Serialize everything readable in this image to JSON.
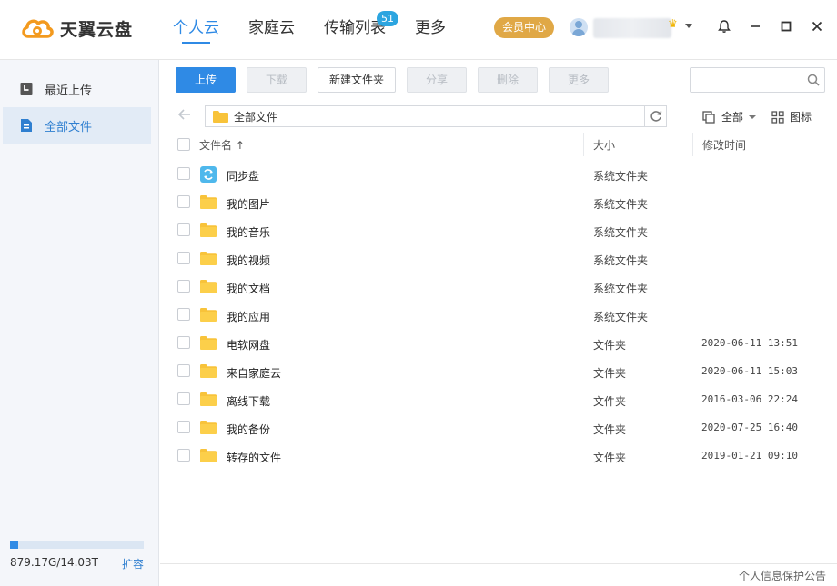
{
  "app": {
    "logo_text": "天翼云盘"
  },
  "nav": {
    "items": [
      {
        "label": "个人云"
      },
      {
        "label": "家庭云"
      },
      {
        "label": "传输列表",
        "badge": "51"
      },
      {
        "label": "更多"
      }
    ]
  },
  "header": {
    "vip_label": "会员中心"
  },
  "sidebar": {
    "items": [
      {
        "label": "最近上传"
      },
      {
        "label": "全部文件"
      }
    ],
    "storage_text": "879.17G/14.03T",
    "storage_used_fraction": 0.061,
    "expand_label": "扩容"
  },
  "toolbar": {
    "upload": "上传",
    "download": "下载",
    "new_folder": "新建文件夹",
    "share": "分享",
    "delete": "删除",
    "more": "更多",
    "search_placeholder": ""
  },
  "pathbar": {
    "path": "全部文件",
    "filter_label": "全部",
    "view_label": "图标"
  },
  "table": {
    "headers": {
      "name": "文件名 ↑",
      "size": "大小",
      "time": "修改时间"
    },
    "rows": [
      {
        "name": "同步盘",
        "size": "系统文件夹",
        "time": "",
        "icon": "sync-folder-icon"
      },
      {
        "name": "我的图片",
        "size": "系统文件夹",
        "time": "",
        "icon": "folder-icon"
      },
      {
        "name": "我的音乐",
        "size": "系统文件夹",
        "time": "",
        "icon": "folder-icon"
      },
      {
        "name": "我的视频",
        "size": "系统文件夹",
        "time": "",
        "icon": "folder-icon"
      },
      {
        "name": "我的文档",
        "size": "系统文件夹",
        "time": "",
        "icon": "folder-icon"
      },
      {
        "name": "我的应用",
        "size": "系统文件夹",
        "time": "",
        "icon": "folder-icon"
      },
      {
        "name": "电软网盘",
        "size": "文件夹",
        "time": "2020-06-11 13:51",
        "icon": "folder-icon"
      },
      {
        "name": "来自家庭云",
        "size": "文件夹",
        "time": "2020-06-11 15:03",
        "icon": "folder-icon"
      },
      {
        "name": "离线下载",
        "size": "文件夹",
        "time": "2016-03-06 22:24",
        "icon": "folder-icon"
      },
      {
        "name": "我的备份",
        "size": "文件夹",
        "time": "2020-07-25 16:40",
        "icon": "folder-icon"
      },
      {
        "name": "转存的文件",
        "size": "文件夹",
        "time": "2019-01-21 09:10",
        "icon": "folder-icon"
      }
    ]
  },
  "footer": {
    "privacy_link": "个人信息保护公告"
  },
  "colors": {
    "accent": "#2f8ae5",
    "vip": "#e0a846",
    "folder": "#f8c33a"
  }
}
